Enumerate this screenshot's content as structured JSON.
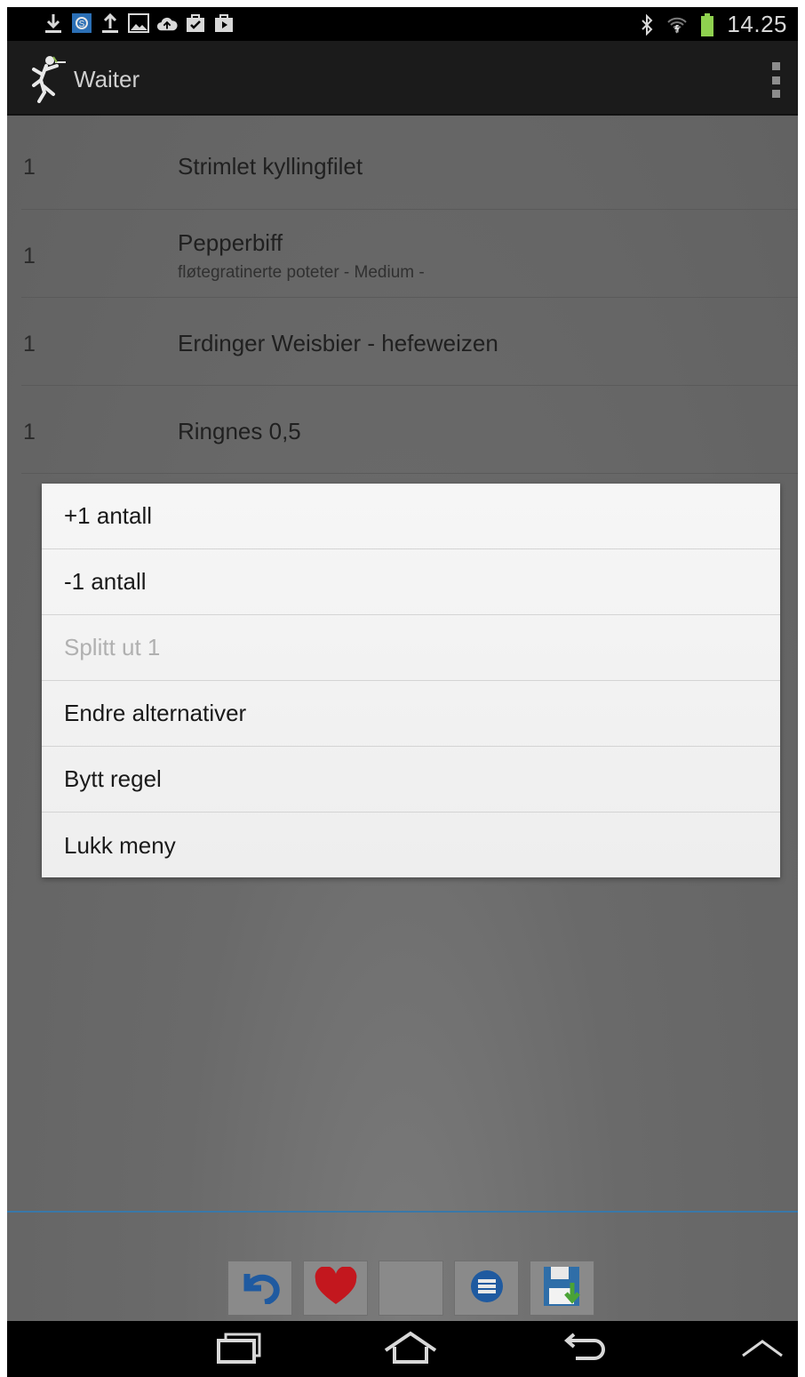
{
  "status_bar": {
    "time": "14.25",
    "left_icons": [
      "download-icon",
      "sync-icon",
      "upload-icon",
      "image-icon",
      "cloud-upload-icon",
      "bag-check-icon",
      "bag-play-icon"
    ],
    "right_icons": [
      "bluetooth-icon",
      "wifi-icon",
      "battery-icon"
    ]
  },
  "action_bar": {
    "title": "Waiter"
  },
  "orders": [
    {
      "qty": "1",
      "name": "Strimlet kyllingfilet",
      "sub": ""
    },
    {
      "qty": "1",
      "name": "Pepperbiff",
      "sub": "fløtegratinerte poteter - Medium -"
    },
    {
      "qty": "1",
      "name": "Erdinger Weisbier - hefeweizen",
      "sub": ""
    },
    {
      "qty": "1",
      "name": "Ringnes 0,5",
      "sub": ""
    }
  ],
  "context_menu": {
    "items": [
      {
        "label": "+1 antall",
        "enabled": true
      },
      {
        "label": "-1 antall",
        "enabled": true
      },
      {
        "label": "Splitt ut 1",
        "enabled": false
      },
      {
        "label": "Endre alternativer",
        "enabled": true
      },
      {
        "label": "Bytt regel",
        "enabled": true
      },
      {
        "label": "Lukk meny",
        "enabled": true
      }
    ]
  },
  "toolbar": {
    "buttons": [
      "undo-icon",
      "heart-icon",
      "blank",
      "list-icon",
      "save-icon"
    ]
  },
  "nav_bar": {
    "buttons": [
      "recent-apps-icon",
      "home-icon",
      "back-icon",
      "up-chevron-icon"
    ]
  },
  "colors": {
    "accent": "#3a78a8",
    "battery": "#8fd14f",
    "heart": "#c3171e",
    "list_button": "#1f5aa0",
    "save": "#2f6ea8"
  }
}
